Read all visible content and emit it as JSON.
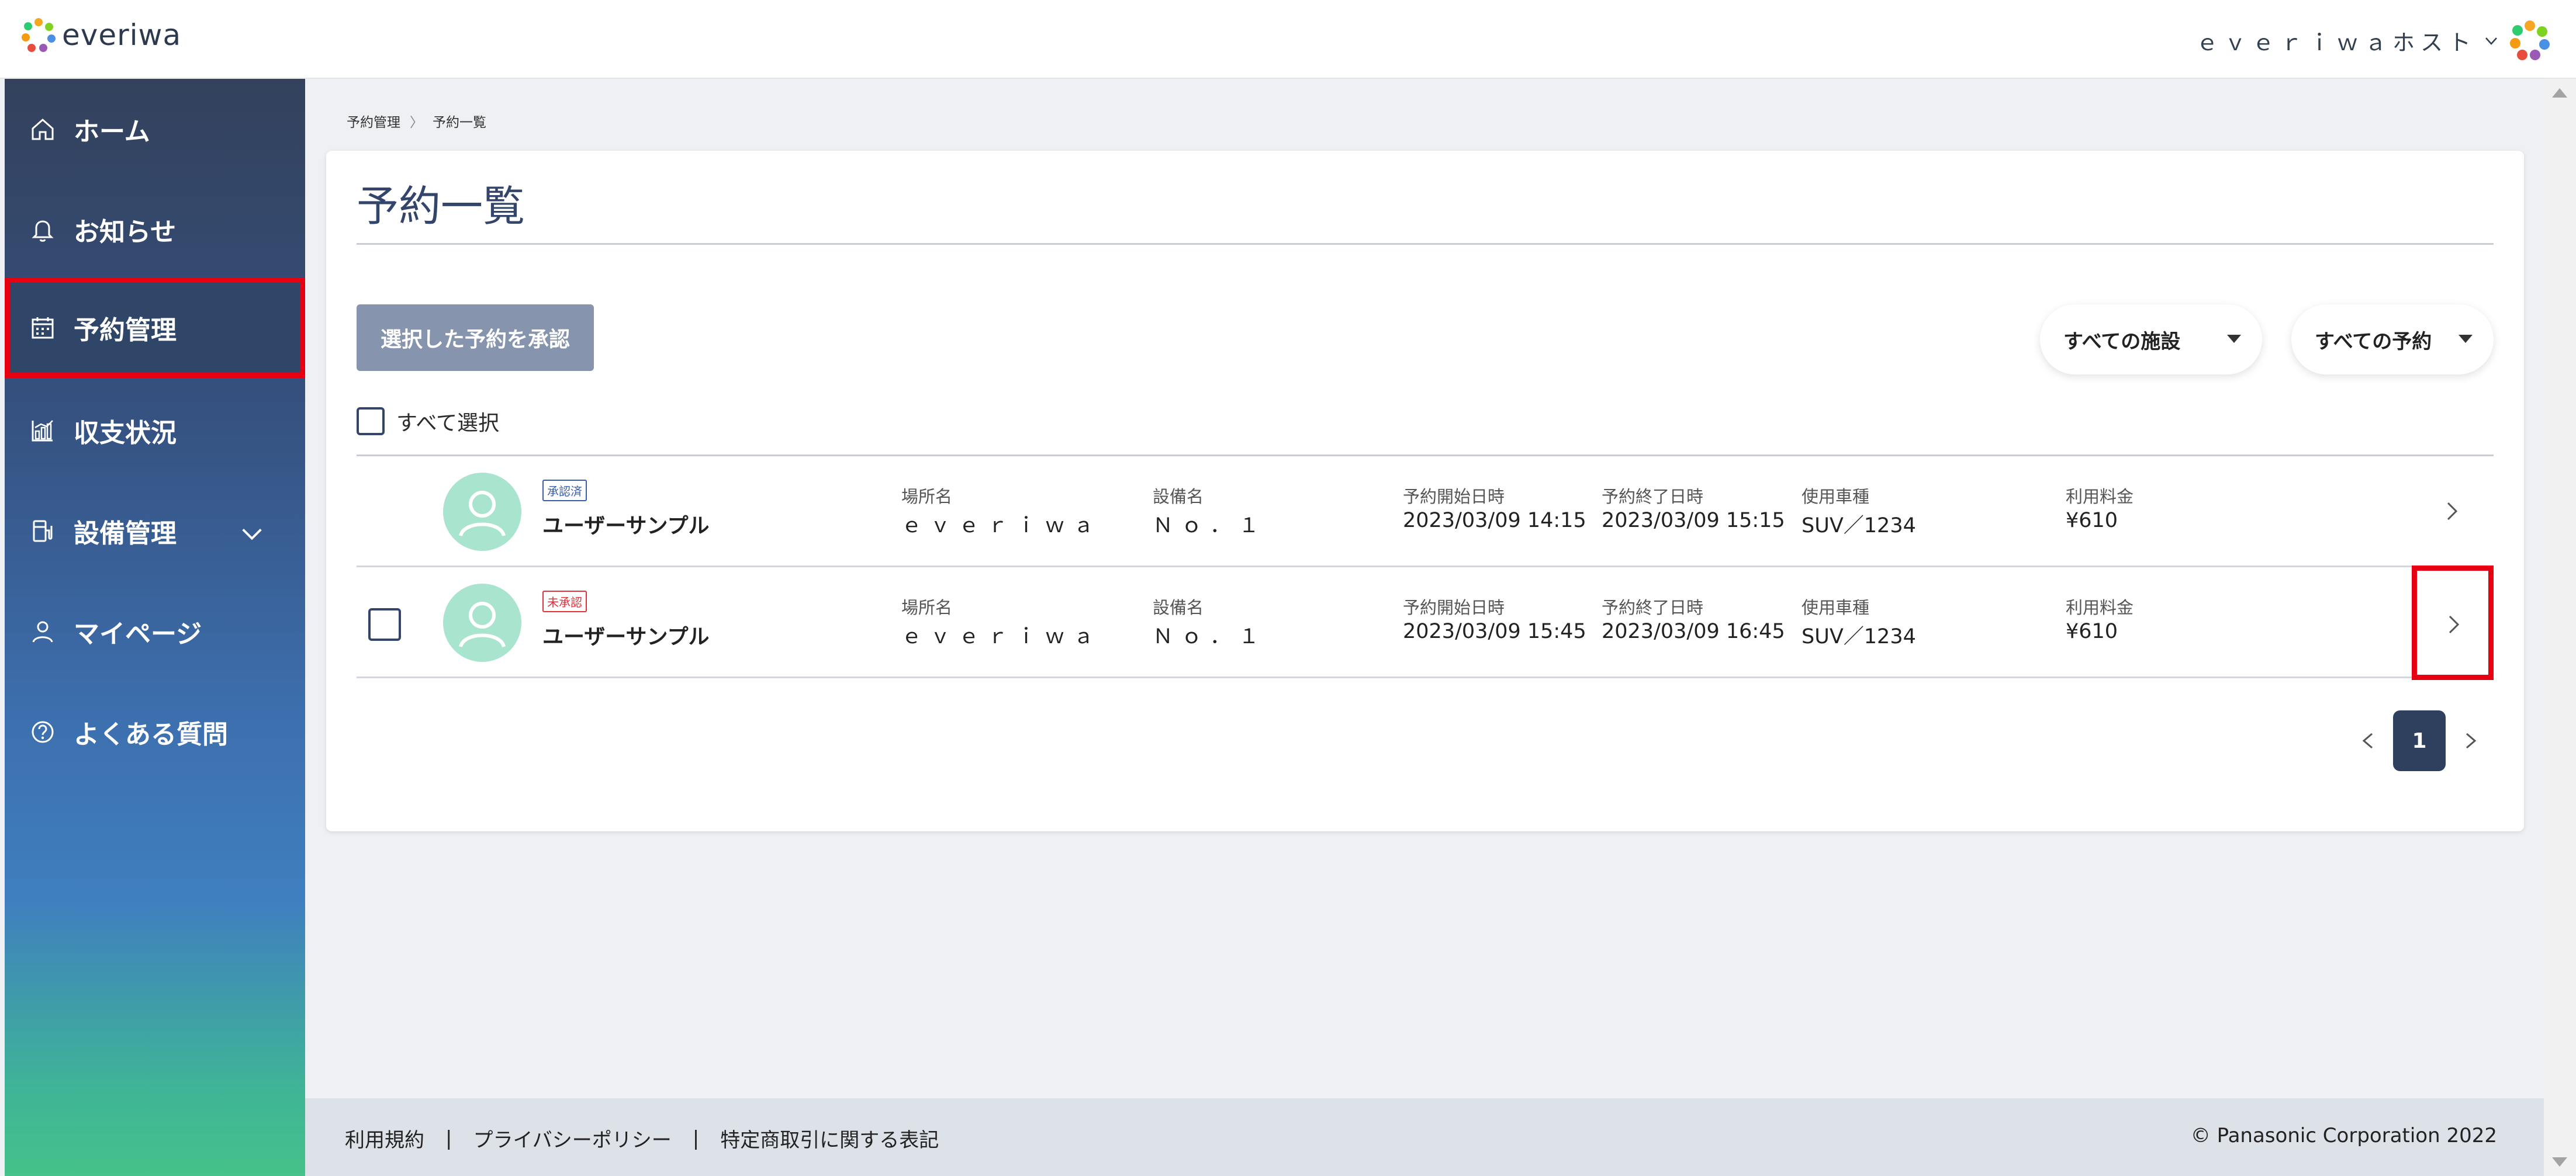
{
  "header": {
    "logo_text": "everiwa",
    "host_name": "ｅｖｅｒｉｗａホスト"
  },
  "sidebar": {
    "items": [
      {
        "label": "ホーム",
        "icon": "home-icon"
      },
      {
        "label": "お知らせ",
        "icon": "bell-icon"
      },
      {
        "label": "予約管理",
        "icon": "calendar-icon",
        "active": true
      },
      {
        "label": "収支状況",
        "icon": "chart-icon"
      },
      {
        "label": "設備管理",
        "icon": "charger-icon",
        "expandable": true
      },
      {
        "label": "マイページ",
        "icon": "user-icon"
      },
      {
        "label": "よくある質問",
        "icon": "question-icon"
      }
    ]
  },
  "breadcrumb": [
    "予約管理",
    "予約一覧"
  ],
  "main": {
    "title": "予約一覧",
    "approve_button": "選択した予約を承認",
    "filter_facility": "すべての施設",
    "filter_reservation": "すべての予約",
    "select_all": "すべて選択"
  },
  "columns": {
    "place": "場所名",
    "equipment": "設備名",
    "start": "予約開始日時",
    "end": "予約終了日時",
    "car": "使用車種",
    "fee": "利用料金"
  },
  "reservations": [
    {
      "status": "承認済",
      "user": "ユーザーサンプル",
      "place": "ｅｖｅｒｉｗａ",
      "equipment": "Ｎｏ．１",
      "start": "2023/03/09 14:15",
      "end": "2023/03/09 15:15",
      "car": "SUV／1234",
      "fee": "¥610"
    },
    {
      "status": "未承認",
      "user": "ユーザーサンプル",
      "place": "ｅｖｅｒｉｗａ",
      "equipment": "Ｎｏ．１",
      "start": "2023/03/09 15:45",
      "end": "2023/03/09 16:45",
      "car": "SUV／1234",
      "fee": "¥610"
    }
  ],
  "pagination": {
    "current": "1"
  },
  "footer": {
    "links": [
      "利用規約",
      "プライバシーポリシー",
      "特定商取引に関する表記"
    ],
    "separator": "|",
    "copyright": "© Panasonic Corporation 2022"
  },
  "colors": {
    "accent_navy": "#33456b",
    "highlight_red": "#e60012",
    "approved_badge": "#3a5ea8",
    "pending_badge": "#e0323a",
    "avatar_green": "#a9e4cf"
  }
}
